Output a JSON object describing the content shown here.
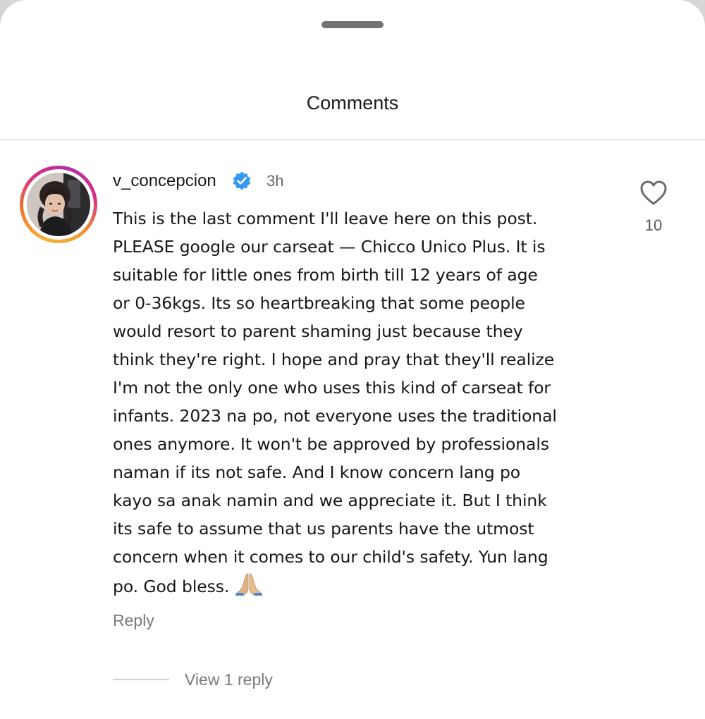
{
  "sheet": {
    "title": "Comments"
  },
  "comment": {
    "username": "v_concepcion",
    "verified": true,
    "timestamp": "3h",
    "text_lines": [
      "This is the last comment I'll leave here on this post.",
      "PLEASE google our carseat — Chicco Unico Plus. It is",
      "suitable for little ones from birth till 12 years of age",
      "or 0-36kgs. Its so heartbreaking that some people",
      "would resort to parent shaming just because they",
      "think they're right. I hope and pray that they'll realize",
      "I'm not the only one who uses this kind of carseat for",
      "infants. 2023 na po, not everyone uses the traditional",
      "ones anymore. It won't be approved by professionals",
      "naman if its not safe. And I know concern lang po",
      "kayo sa anak namin and we appreciate it. But I think",
      "its safe to assume that us parents have the utmost",
      "concern when it comes to our child's safety. Yun lang",
      "po. God bless."
    ],
    "emoji": "folded-hands",
    "like_count": "10",
    "reply_label": "Reply",
    "view_replies_label": "View 1 reply"
  },
  "icons": {
    "like": "heart-outline-icon",
    "verified": "verified-badge-icon"
  },
  "colors": {
    "verified_blue": "#3897f0",
    "text": "#161616",
    "muted": "#7a7a7a",
    "divider": "#e3e3e3"
  }
}
